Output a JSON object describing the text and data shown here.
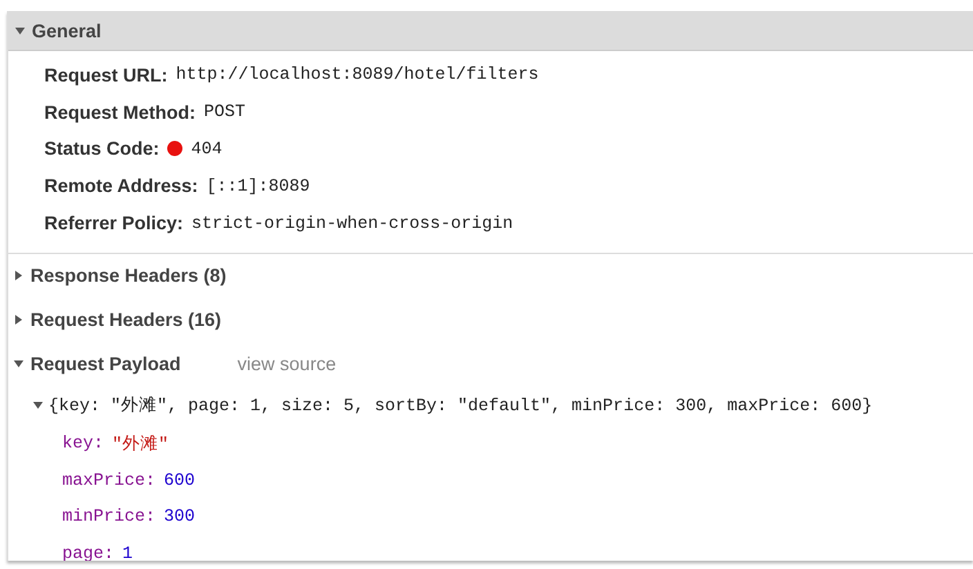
{
  "general": {
    "title": "General",
    "expanded": true,
    "fields": [
      {
        "label": "Request URL:",
        "value": "http://localhost:8089/hotel/filters"
      },
      {
        "label": "Request Method:",
        "value": "POST"
      },
      {
        "label": "Status Code:",
        "value": "404",
        "color": "#e8110f"
      },
      {
        "label": "Remote Address:",
        "value": "[::1]:8089"
      },
      {
        "label": "Referrer Policy:",
        "value": "strict-origin-when-cross-origin"
      }
    ]
  },
  "sections": [
    {
      "title": "Response Headers (8)",
      "expanded": false
    },
    {
      "title": "Request Headers (16)",
      "expanded": false
    }
  ],
  "payload": {
    "title": "Request Payload",
    "expanded": true,
    "link": "view source",
    "summary": {
      "text": "{key: \"外滩\", page: 1, size: 5, sortBy: \"default\", minPrice: 300, maxPrice: 600}",
      "expanded": true
    },
    "entries": [
      {
        "key": "key:",
        "value": "\"外滩\"",
        "kind": "string"
      },
      {
        "key": "maxPrice:",
        "value": "600",
        "kind": "number"
      },
      {
        "key": "minPrice:",
        "value": "300",
        "kind": "number"
      },
      {
        "key": "page:",
        "value": "1",
        "kind": "number"
      }
    ]
  }
}
